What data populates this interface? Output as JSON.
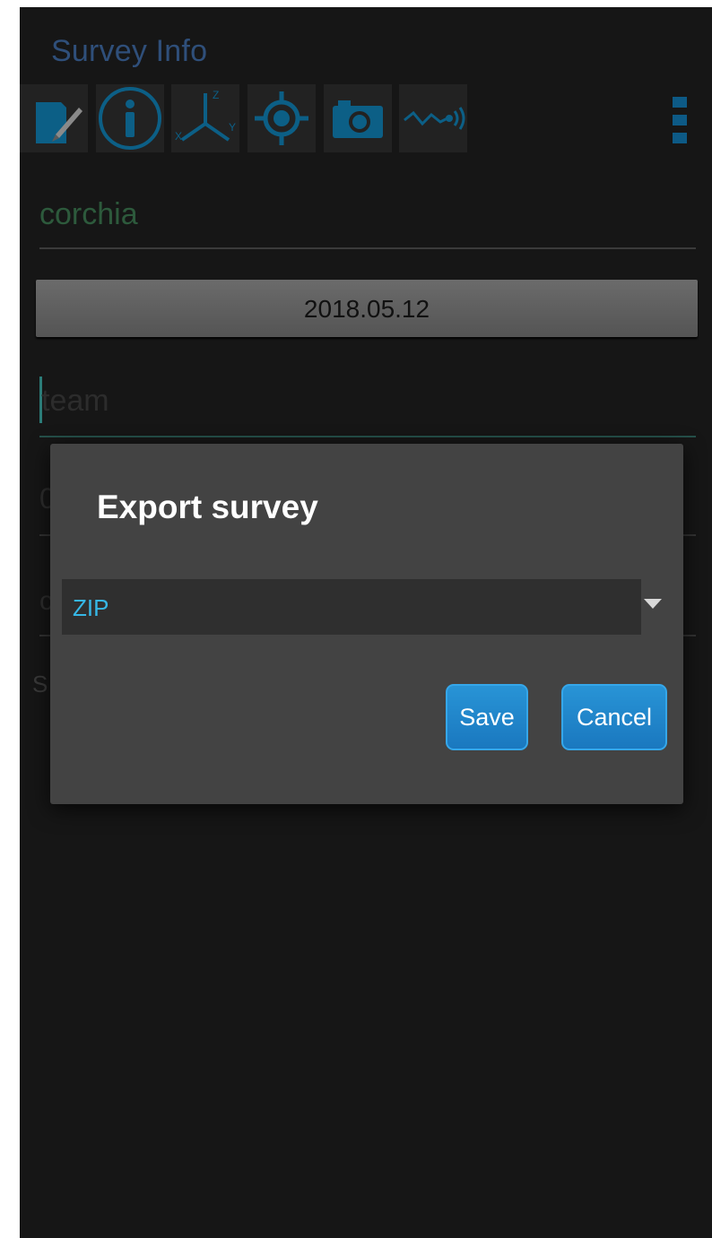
{
  "header": {
    "title": "Survey Info",
    "toolbar": [
      {
        "icon": "note-edit-icon"
      },
      {
        "icon": "info-icon"
      },
      {
        "icon": "axes-icon",
        "axis_labels": [
          "X",
          "Y",
          "Z"
        ]
      },
      {
        "icon": "location-target-icon"
      },
      {
        "icon": "camera-icon"
      },
      {
        "icon": "sensor-signal-icon"
      }
    ],
    "overflow_icon": "overflow-menu-icon"
  },
  "form": {
    "survey_name": "corchia",
    "date": "2018.05.12",
    "team_placeholder": "team",
    "field4_partial": "0",
    "field5_partial": "c",
    "field6_partial": "S"
  },
  "dialog": {
    "title": "Export survey",
    "format": {
      "selected": "ZIP",
      "arrow_icon": "dropdown-arrow-icon"
    },
    "save_label": "Save",
    "cancel_label": "Cancel"
  },
  "colors": {
    "accent": "#36b7e6",
    "button": "#1e84c8",
    "dialog_bg": "#434343",
    "screen_bg": "#161616"
  }
}
